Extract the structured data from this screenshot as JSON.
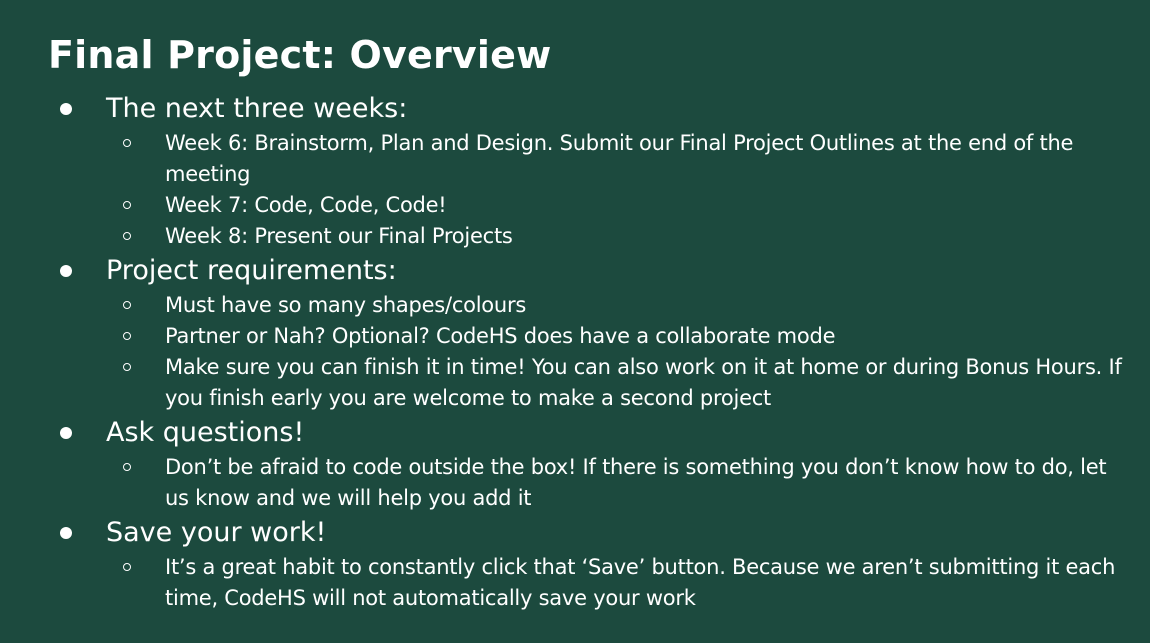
{
  "slide": {
    "title": "Final Project: Overview",
    "bullets": [
      {
        "text": "The next three weeks:",
        "subs": [
          "Week 6: Brainstorm, Plan and Design. Submit our Final Project Outlines at the end of the meeting",
          "Week 7: Code, Code, Code!",
          "Week 8: Present our Final Projects"
        ]
      },
      {
        "text": "Project requirements:",
        "subs": [
          "Must have so many shapes/colours",
          "Partner or Nah? Optional? CodeHS does have a collaborate mode",
          "Make sure you can finish it in time! You can also work on it at home or during Bonus Hours. If you finish early you are welcome to make a second project"
        ]
      },
      {
        "text": "Ask questions!",
        "subs": [
          "Don’t be afraid to code outside the box! If there is something you don’t know how to do, let us know and we will help you add it"
        ]
      },
      {
        "text": "Save your work!",
        "subs": [
          "It’s a great habit to constantly click that ‘Save’ button. Because we aren’t submitting it each time, CodeHS will not automatically save your work"
        ]
      }
    ]
  },
  "colors": {
    "background": "#1c4a3e",
    "text": "#ffffff"
  }
}
